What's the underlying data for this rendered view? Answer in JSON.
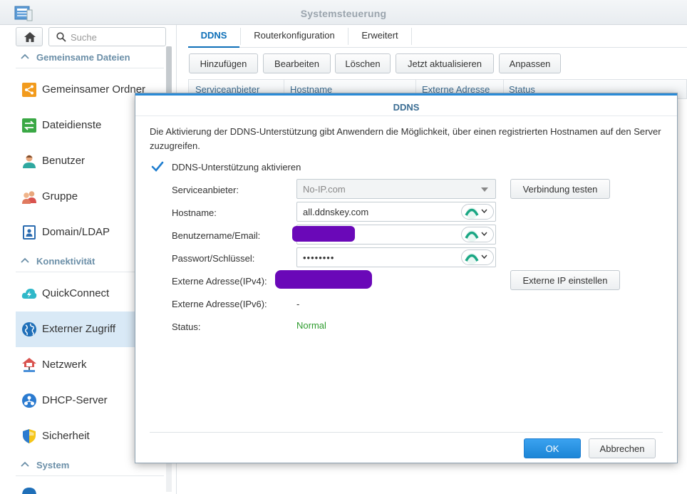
{
  "window": {
    "title": "Systemsteuerung",
    "icon": "control-panel-icon"
  },
  "sidebar": {
    "search_placeholder": "Suche",
    "sections": [
      {
        "title": "Gemeinsame Dateien",
        "items": [
          {
            "label": "Gemeinsamer Ordner",
            "icon": "shared-folder-icon"
          },
          {
            "label": "Dateidienste",
            "icon": "file-services-icon"
          },
          {
            "label": "Benutzer",
            "icon": "user-icon"
          },
          {
            "label": "Gruppe",
            "icon": "group-icon"
          },
          {
            "label": "Domain/LDAP",
            "icon": "domain-ldap-icon"
          }
        ]
      },
      {
        "title": "Konnektivität",
        "items": [
          {
            "label": "QuickConnect",
            "icon": "quickconnect-icon"
          },
          {
            "label": "Externer Zugriff",
            "icon": "external-access-icon",
            "active": true
          },
          {
            "label": "Netzwerk",
            "icon": "network-icon"
          },
          {
            "label": "DHCP-Server",
            "icon": "dhcp-server-icon"
          },
          {
            "label": "Sicherheit",
            "icon": "security-icon"
          }
        ]
      },
      {
        "title": "System",
        "items": []
      }
    ]
  },
  "tabs": [
    {
      "label": "DDNS",
      "active": true
    },
    {
      "label": "Routerkonfiguration"
    },
    {
      "label": "Erweitert"
    }
  ],
  "toolbar": {
    "add": "Hinzufügen",
    "edit": "Bearbeiten",
    "delete": "Löschen",
    "refresh": "Jetzt aktualisieren",
    "customize": "Anpassen"
  },
  "grid": {
    "columns": [
      "Serviceanbieter",
      "Hostname",
      "Externe Adresse",
      "Status"
    ]
  },
  "dialog": {
    "title": "DDNS",
    "description": "Die Aktivierung der DDNS-Unterstützung gibt Anwendern die Möglichkeit, über einen registrierten Hostnamen auf den Server zuzugreifen.",
    "enable_label": "DDNS-Unterstützung aktivieren",
    "enable_checked": true,
    "fields": {
      "provider_label": "Serviceanbieter:",
      "provider_value": "No-IP.com",
      "hostname_label": "Hostname:",
      "hostname_value": "all.ddnskey.com",
      "username_label": "Benutzername/Email:",
      "password_label": "Passwort/Schlüssel:",
      "password_value": "••••••••",
      "ipv4_label": "Externe Adresse(IPv4):",
      "ipv6_label": "Externe Adresse(IPv6):",
      "ipv6_value": "-",
      "status_label": "Status:",
      "status_value": "Normal"
    },
    "test_button": "Verbindung testen",
    "set_ip_button": "Externe IP einstellen",
    "ok_button": "OK",
    "cancel_button": "Abbrechen"
  },
  "colors": {
    "accent": "#0d6fb8",
    "status_ok": "#2e9c2e",
    "redaction": "#6a08b8"
  }
}
